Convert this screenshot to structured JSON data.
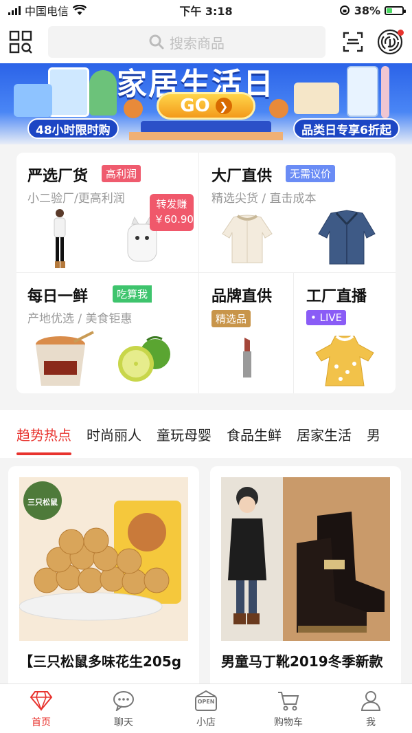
{
  "status_bar": {
    "carrier": "中国电信",
    "time": "下午 3:18",
    "battery": "38%",
    "battery_fraction": 0.38
  },
  "header": {
    "search_placeholder": "搜索商品",
    "icons": [
      "grid-search-icon",
      "scan-icon",
      "fingerprint-icon"
    ]
  },
  "banner": {
    "title": "家居生活日",
    "go_label": "GO",
    "left_pill": "48小时限时购",
    "right_pill": "品类日专享6折起"
  },
  "categories": {
    "yanxuan": {
      "title": "严选厂货",
      "tag": "高利润",
      "subtitle": "小二验厂/更高利润",
      "price_tag_label": "转发赚",
      "price_tag_value": "￥60.90"
    },
    "dachang": {
      "title": "大厂直供",
      "tag": "无需议价",
      "subtitle": "精选尖货 / 直击成本"
    },
    "meiri": {
      "title": "每日一鲜",
      "tag": "吃算我",
      "subtitle": "产地优选 / 美食钜惠"
    },
    "pinpai": {
      "title": "品牌直供",
      "tag": "精选品"
    },
    "gongchang": {
      "title": "工厂直播",
      "tag": "• LIVE"
    }
  },
  "tabs": [
    "趋势热点",
    "时尚丽人",
    "童玩母婴",
    "食品生鲜",
    "居家生活",
    "男"
  ],
  "products": [
    {
      "title": "【三只松鼠多味花生205g",
      "brand_badge": "三只松鼠"
    },
    {
      "title": "男童马丁靴2019冬季新款"
    }
  ],
  "bottom_nav": [
    {
      "label": "首页",
      "icon": "diamond-icon"
    },
    {
      "label": "聊天",
      "icon": "chat-icon"
    },
    {
      "label": "小店",
      "icon": "shop-icon",
      "badge": "OPEN"
    },
    {
      "label": "购物车",
      "icon": "cart-icon"
    },
    {
      "label": "我",
      "icon": "person-icon"
    }
  ],
  "colors": {
    "accent": "#e8332e",
    "tag_pink": "#ef5b6e",
    "tag_blue": "#6a8cf5",
    "tag_green": "#3ec46d",
    "tag_gold": "#c8954a",
    "tag_purple": "#8a5cf6"
  }
}
